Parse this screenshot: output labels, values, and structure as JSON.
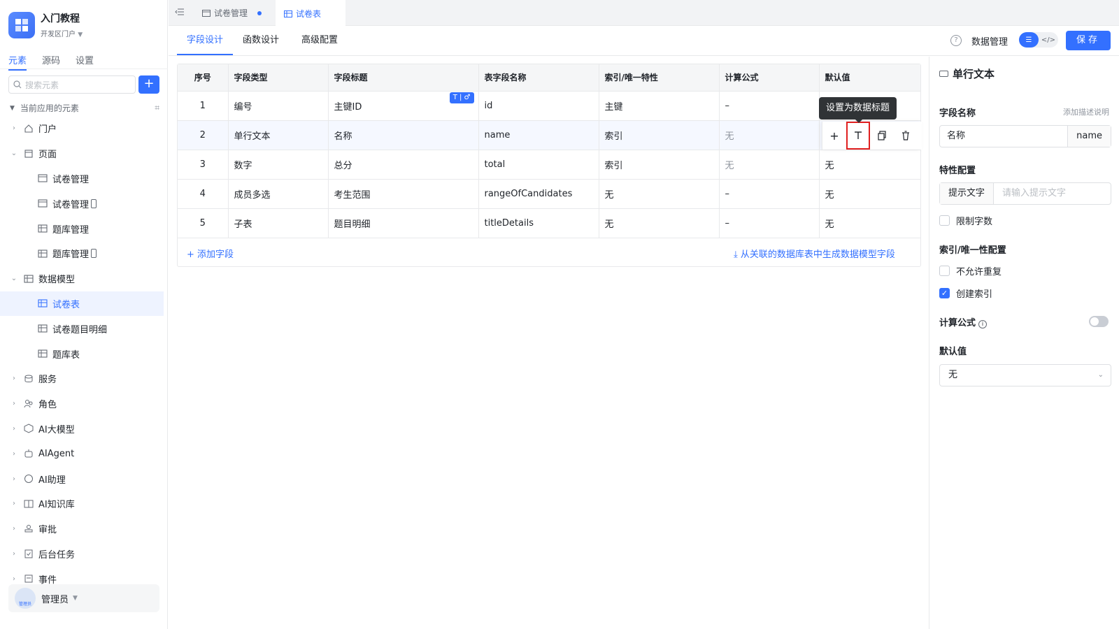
{
  "app": {
    "name": "入门教程",
    "portal": "开发区门户"
  },
  "sidebar": {
    "tabs": [
      "元素",
      "源码",
      "设置"
    ],
    "search_placeholder": "搜索元素",
    "section_label": "当前应用的元素",
    "items": [
      {
        "label": "门户"
      },
      {
        "label": "页面"
      },
      {
        "label": "试卷管理"
      },
      {
        "label": "试卷管理"
      },
      {
        "label": "题库管理"
      },
      {
        "label": "题库管理"
      },
      {
        "label": "数据模型"
      },
      {
        "label": "试卷表"
      },
      {
        "label": "试卷题目明细"
      },
      {
        "label": "题库表"
      },
      {
        "label": "服务"
      },
      {
        "label": "角色"
      },
      {
        "label": "AI大模型"
      },
      {
        "label": "AIAgent"
      },
      {
        "label": "AI助理"
      },
      {
        "label": "AI知识库"
      },
      {
        "label": "审批"
      },
      {
        "label": "后台任务"
      },
      {
        "label": "事件"
      }
    ],
    "user": {
      "name": "管理员",
      "avatar_text": "管理员"
    }
  },
  "top_tabs": [
    {
      "label": "试卷管理"
    },
    {
      "label": "试卷表"
    }
  ],
  "sub_tabs": [
    "字段设计",
    "函数设计",
    "高级配置"
  ],
  "toolbar": {
    "data_manage": "数据管理",
    "save": "保存"
  },
  "table": {
    "headers": [
      "序号",
      "字段类型",
      "字段标题",
      "表字段名称",
      "索引/唯一特性",
      "计算公式",
      "默认值"
    ],
    "rows": [
      {
        "no": "1",
        "type": "编号",
        "title": "主键ID",
        "name": "id",
        "index": "主键",
        "formula": "–",
        "default": ""
      },
      {
        "no": "2",
        "type": "单行文本",
        "title": "名称",
        "name": "name",
        "index": "索引",
        "formula": "无",
        "default": ""
      },
      {
        "no": "3",
        "type": "数字",
        "title": "总分",
        "name": "total",
        "index": "索引",
        "formula": "无",
        "default": "无"
      },
      {
        "no": "4",
        "type": "成员多选",
        "title": "考生范围",
        "name": "rangeOfCandidates",
        "index": "无",
        "formula": "–",
        "default": "无"
      },
      {
        "no": "5",
        "type": "子表",
        "title": "题目明细",
        "name": "titleDetails",
        "index": "无",
        "formula": "–",
        "default": "无"
      }
    ],
    "title_badge": "T | ♂",
    "add_field": "+ 添加字段",
    "generate_field": "从关联的数据库表中生成数据模型字段",
    "tooltip": "设置为数据标题"
  },
  "panel": {
    "title": "单行文本",
    "field_name_label": "字段名称",
    "add_desc": "添加描述说明",
    "field_name_value": "名称",
    "field_name_suffix": "name",
    "feature_label": "特性配置",
    "hint_prefix": "提示文字",
    "hint_placeholder": "请输入提示文字",
    "limit_chars": "限制字数",
    "index_label": "索引/唯一性配置",
    "no_duplicate": "不允许重复",
    "create_index": "创建索引",
    "formula_label": "计算公式",
    "default_label": "默认值",
    "default_value": "无"
  }
}
